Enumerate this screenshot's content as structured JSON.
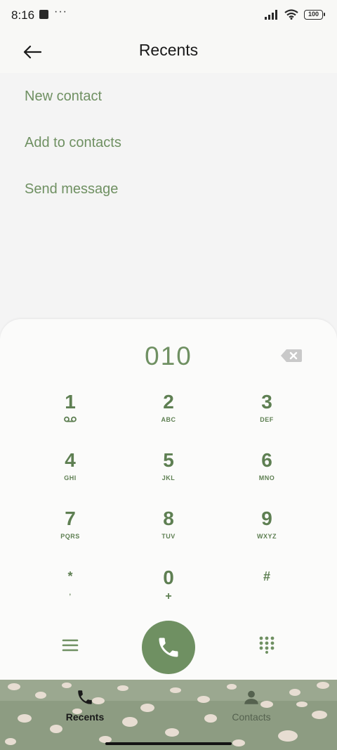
{
  "status_bar": {
    "time": "8:16",
    "dots": "···",
    "battery": "100"
  },
  "header": {
    "title": "Recents",
    "back_icon": "arrow-left-icon"
  },
  "actions": [
    {
      "label": "New contact"
    },
    {
      "label": "Add to contacts"
    },
    {
      "label": "Send message"
    }
  ],
  "dialer": {
    "number": "010",
    "keys": [
      {
        "digit": "1",
        "letters": "voicemail-icon"
      },
      {
        "digit": "2",
        "letters": "ABC"
      },
      {
        "digit": "3",
        "letters": "DEF"
      },
      {
        "digit": "4",
        "letters": "GHI"
      },
      {
        "digit": "5",
        "letters": "JKL"
      },
      {
        "digit": "6",
        "letters": "MNO"
      },
      {
        "digit": "7",
        "letters": "PQRS"
      },
      {
        "digit": "8",
        "letters": "TUV"
      },
      {
        "digit": "9",
        "letters": "WXYZ"
      },
      {
        "digit": "*",
        "letters": ","
      },
      {
        "digit": "0",
        "letters": "+"
      },
      {
        "digit": "#",
        "letters": ""
      }
    ]
  },
  "bottom_nav": {
    "tabs": [
      {
        "label": "Recents",
        "active": true,
        "icon": "phone-icon"
      },
      {
        "label": "Contacts",
        "active": false,
        "icon": "person-icon"
      }
    ]
  },
  "colors": {
    "accent": "#6f9062",
    "key_text": "#5e7f52",
    "background": "#f4f4f4",
    "sheet": "#fbfbfa"
  }
}
